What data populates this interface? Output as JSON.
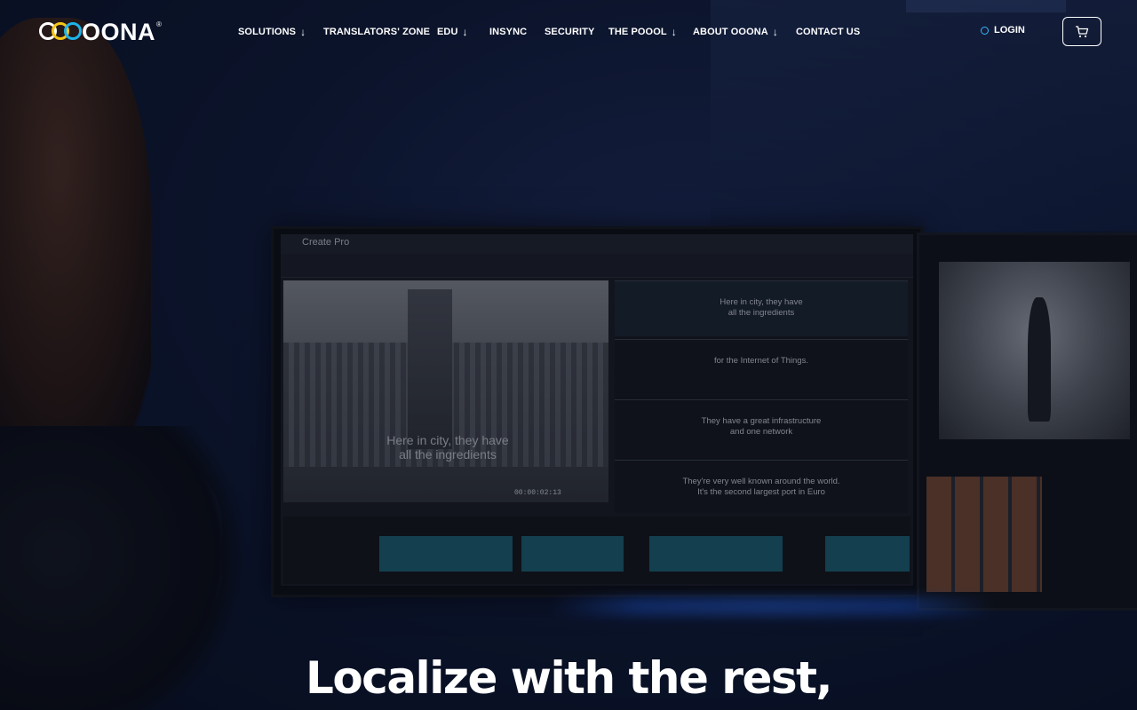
{
  "brand": {
    "name": "OONA",
    "registered": "®",
    "ring_colors": [
      "#ffffff",
      "#f5c518",
      "#1fb3e8"
    ]
  },
  "nav": {
    "items": [
      {
        "label": "SOLUTIONS",
        "has_dropdown": true
      },
      {
        "label": "TRANSLATORS' ZONE",
        "has_dropdown": false
      },
      {
        "label": "EDU",
        "has_dropdown": true
      },
      {
        "label": "INSYNC",
        "has_dropdown": false
      },
      {
        "label": "SECURITY",
        "has_dropdown": false
      },
      {
        "label": "THE POOOL",
        "has_dropdown": true
      },
      {
        "label": "ABOUT OOONA",
        "has_dropdown": true
      },
      {
        "label": "CONTACT US",
        "has_dropdown": false
      }
    ],
    "dropdown_arrow": "↓",
    "login_label": "LOGIN",
    "login_icon": "user-icon",
    "cart_icon": "cart-icon"
  },
  "hero": {
    "headline": "Localize with the rest,"
  },
  "screen_app": {
    "title": "Create Pro",
    "timecode": "00:00:02:13",
    "video_subtitle": [
      "Here in city, they have",
      "all the ingredients"
    ],
    "subtitle_rows": [
      [
        "Here in city, they have",
        "all the ingredients"
      ],
      [
        "for the Internet of Things."
      ],
      [
        "They have a great infrastructure",
        "and one network"
      ],
      [
        "They're very well known around the world.",
        "It's the second largest port in Euro"
      ]
    ]
  },
  "colors": {
    "accent": "#39b6ff",
    "text": "#ffffff",
    "background": "#0f1a36"
  }
}
